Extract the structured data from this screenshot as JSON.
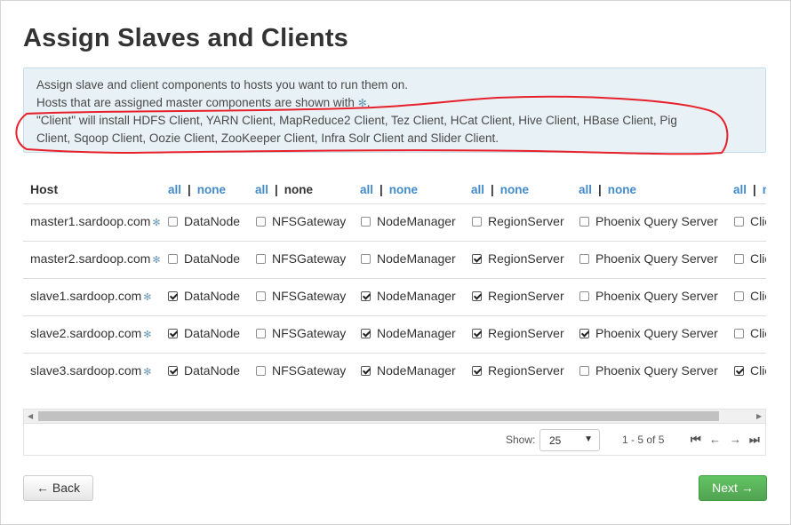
{
  "page_title": "Assign Slaves and Clients",
  "alert": {
    "line1": "Assign slave and client components to hosts you want to run them on.",
    "line2": "Hosts that are assigned master components are shown with",
    "line3": "\"Client\" will install HDFS Client, YARN Client, MapReduce2 Client, Tez Client, HCat Client, Hive Client, HBase Client, Pig",
    "line4": "Client, Sqoop Client, Oozie Client, ZooKeeper Client, Infra Solr Client and Slider Client.",
    "marker_glyph": "✻",
    "period": "."
  },
  "table": {
    "host_header": "Host",
    "all_label": "all",
    "none_label": "none",
    "separator": "|",
    "master_marker": "✻",
    "components": [
      "DataNode",
      "NFSGateway",
      "NodeManager",
      "RegionServer",
      "Phoenix Query Server",
      "Client"
    ],
    "rows": [
      {
        "host": "master1.sardoop.com",
        "checks": [
          false,
          false,
          false,
          false,
          false,
          false
        ]
      },
      {
        "host": "master2.sardoop.com",
        "checks": [
          false,
          false,
          false,
          true,
          false,
          false
        ]
      },
      {
        "host": "slave1.sardoop.com",
        "checks": [
          true,
          false,
          true,
          true,
          false,
          false
        ]
      },
      {
        "host": "slave2.sardoop.com",
        "checks": [
          true,
          false,
          true,
          true,
          true,
          false
        ]
      },
      {
        "host": "slave3.sardoop.com",
        "checks": [
          true,
          false,
          true,
          true,
          false,
          true
        ]
      }
    ]
  },
  "pagination": {
    "show_label": "Show:",
    "page_size": "25",
    "range": "1 - 5 of 5"
  },
  "buttons": {
    "back": "← Back",
    "next": "Next →"
  },
  "colors": {
    "link": "#428bca",
    "alert_bg": "#e7f1f6",
    "next_green": "#5bb75b",
    "annotation_red": "#e8202a"
  }
}
